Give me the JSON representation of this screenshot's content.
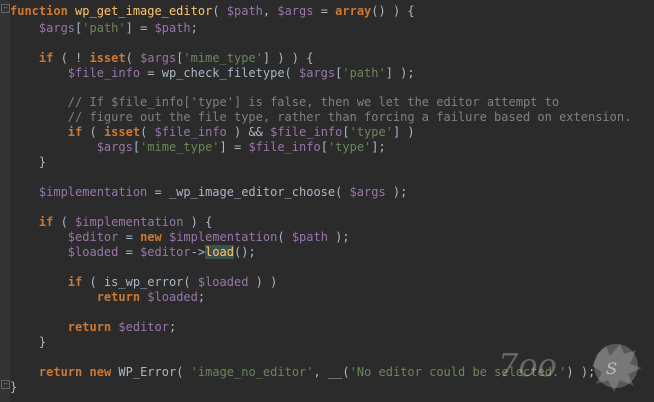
{
  "code": {
    "l1": {
      "kw": "function",
      "fn": "wp_get_image_editor",
      "p1": "( ",
      "v1": "$path",
      "p2": ", ",
      "v2": "$args",
      "p3": " = ",
      "kw2": "array",
      "p4": "() ) {"
    },
    "l2": {
      "v1": "$args",
      "p1": "[",
      "s1": "'path'",
      "p2": "] = ",
      "v2": "$path",
      "p3": ";"
    },
    "l3": {
      "kw1": "if",
      "p1": " ( ! ",
      "kw2": "isset",
      "p2": "( ",
      "v1": "$args",
      "p3": "[",
      "s1": "'mime_type'",
      "p4": "] ) ) {"
    },
    "l4": {
      "v1": "$file_info",
      "p1": " = wp_check_filetype( ",
      "v2": "$args",
      "p2": "[",
      "s1": "'path'",
      "p3": "] );"
    },
    "l5": {
      "c": "// If $file_info['type'] is false, then we let the editor attempt to"
    },
    "l6": {
      "c": "// figure out the file type, rather than forcing a failure based on extension."
    },
    "l7": {
      "kw1": "if",
      "p1": " ( ",
      "kw2": "isset",
      "p2": "( ",
      "v1": "$file_info",
      "p3": " ) && ",
      "v2": "$file_info",
      "p4": "[",
      "s1": "'type'",
      "p5": "] )"
    },
    "l8": {
      "v1": "$args",
      "p1": "[",
      "s1": "'mime_type'",
      "p2": "] = ",
      "v2": "$file_info",
      "p3": "[",
      "s2": "'type'",
      "p4": "];"
    },
    "l9": {
      "p1": "}"
    },
    "l10": {
      "v1": "$implementation",
      "p1": " = _wp_image_editor_choose( ",
      "v2": "$args",
      "p2": " );"
    },
    "l11": {
      "kw1": "if",
      "p1": " ( ",
      "v1": "$implementation",
      "p2": " ) {"
    },
    "l12": {
      "v1": "$editor",
      "p1": " = ",
      "kw1": "new",
      "p2": " ",
      "v2": "$implementation",
      "p3": "( ",
      "v3": "$path",
      "p4": " );"
    },
    "l13": {
      "v1": "$loaded",
      "p1": " = ",
      "v2": "$editor",
      "p2": "->",
      "h1": "load",
      "p3": "();"
    },
    "l14": {
      "kw1": "if",
      "p1": " ( is_wp_error( ",
      "v1": "$loaded",
      "p2": " ) )"
    },
    "l15": {
      "kw1": "return",
      "p1": " ",
      "v1": "$loaded",
      "p2": ";"
    },
    "l16": {
      "kw1": "return",
      "p1": " ",
      "v1": "$editor",
      "p2": ";"
    },
    "l17": {
      "p1": "}"
    },
    "l18": {
      "kw1": "return",
      "p1": " ",
      "kw2": "new",
      "p2": " WP_Error( ",
      "s1": "'image_no_editor'",
      "p3": ", __(",
      "s2": "'No editor could be selected.'",
      "p4": ") );"
    },
    "l19": {
      "p1": "}"
    }
  },
  "colors": {
    "background": "#2b2b2b",
    "keyword": "#cc7832",
    "function": "#ffc66d",
    "variable": "#9876aa",
    "string": "#6a8759",
    "comment": "#808080"
  }
}
